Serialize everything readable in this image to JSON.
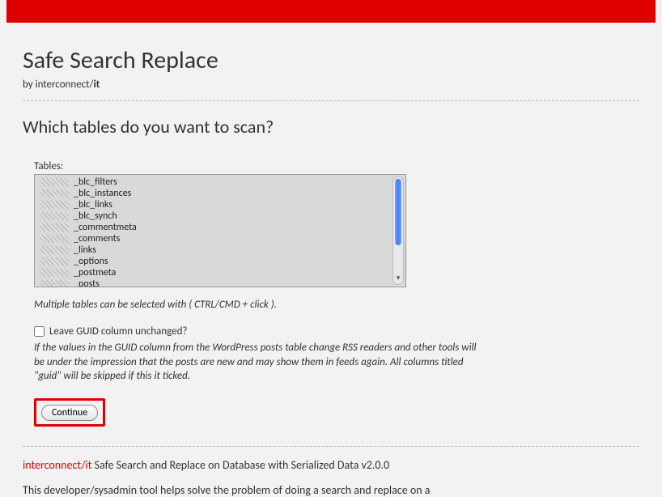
{
  "header": {
    "title": "Safe Search Replace",
    "byline_prefix": "by interconnect/",
    "byline_bold": "it"
  },
  "main": {
    "question": "Which tables do you want to scan?",
    "tables_label": "Tables:",
    "table_items": [
      "_blc_filters",
      "_blc_instances",
      "_blc_links",
      "_blc_synch",
      "_commentmeta",
      "_comments",
      "_links",
      "_options",
      "_postmeta",
      "_posts"
    ],
    "multi_hint": "Multiple tables can be selected with ( CTRL/CMD + click ).",
    "guid_label": "Leave GUID column unchanged?",
    "guid_help": "If the values in the GUID column from the WordPress posts table change RSS readers and other tools will be under the impression that the posts are new and may show them in feeds again. All columns titled \"guid\" will be skipped if this it ticked.",
    "continue_label": "Continue"
  },
  "footer": {
    "brand": "interconnect/it",
    "title_rest": " Safe Search and Replace on Database with Serialized Data v2.0.0",
    "desc": "This developer/sysadmin tool helps solve the problem of doing a search and replace on a"
  }
}
